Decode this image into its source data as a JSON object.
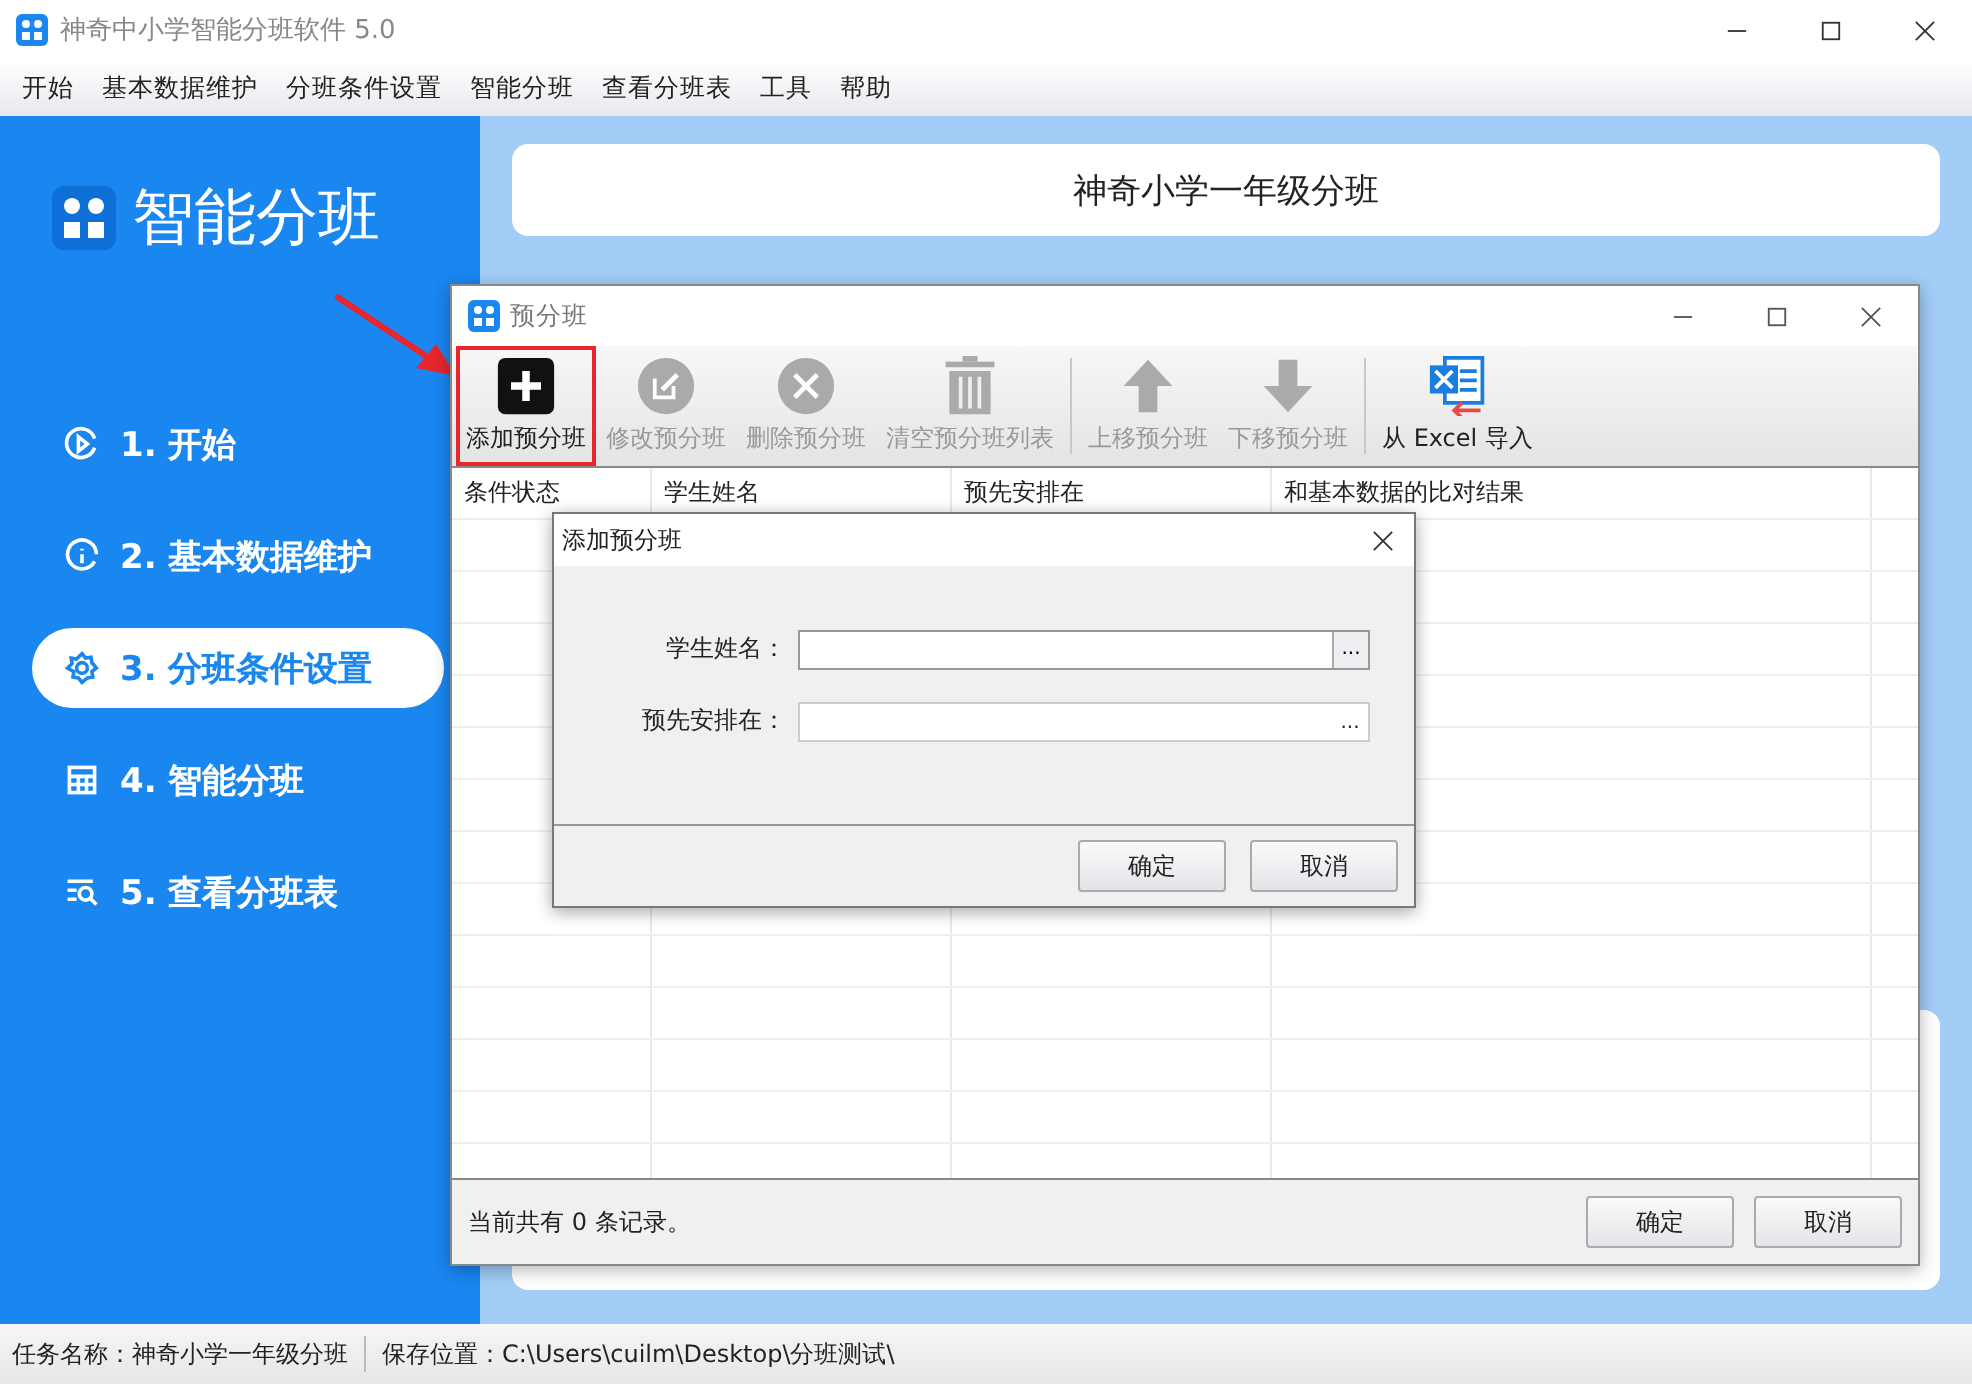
{
  "window": {
    "title": "神奇中小学智能分班软件 5.0"
  },
  "menu": [
    "开始",
    "基本数据维护",
    "分班条件设置",
    "智能分班",
    "查看分班表",
    "工具",
    "帮助"
  ],
  "sidebar": {
    "title": "智能分班",
    "items": [
      {
        "label": "1. 开始",
        "kind": "play",
        "selected": false
      },
      {
        "label": "2. 基本数据维护",
        "kind": "info",
        "selected": false
      },
      {
        "label": "3. 分班条件设置",
        "kind": "gear",
        "selected": true
      },
      {
        "label": "4. 智能分班",
        "kind": "grid",
        "selected": false
      },
      {
        "label": "5. 查看分班表",
        "kind": "search",
        "selected": false
      }
    ]
  },
  "header": {
    "title": "神奇小学一年级分班"
  },
  "dialog": {
    "title": "预分班",
    "toolbar": [
      [
        {
          "label": "添加预分班",
          "kind": "plus",
          "disabled": false,
          "highlighted": true
        },
        {
          "label": "修改预分班",
          "kind": "edit",
          "disabled": true,
          "highlighted": false
        },
        {
          "label": "删除预分班",
          "kind": "delete",
          "disabled": true,
          "highlighted": false
        },
        {
          "label": "清空预分班列表",
          "kind": "trash",
          "disabled": true,
          "highlighted": false
        }
      ],
      [
        {
          "label": "上移预分班",
          "kind": "up",
          "disabled": true,
          "highlighted": false
        },
        {
          "label": "下移预分班",
          "kind": "down",
          "disabled": true,
          "highlighted": false
        }
      ],
      [
        {
          "label": "从 Excel 导入",
          "kind": "excel",
          "disabled": false,
          "highlighted": false
        }
      ]
    ],
    "columns": [
      "条件状态",
      "学生姓名",
      "预先安排在",
      "和基本数据的比对结果"
    ],
    "record_count": "当前共有 0 条记录。",
    "buttons": [
      "确定",
      "取消"
    ]
  },
  "add_dialog": {
    "title": "添加预分班",
    "fields": [
      {
        "label": "学生姓名：",
        "kind": "browse",
        "button": "..."
      },
      {
        "label": "预先安排在：",
        "kind": "inline",
        "button": "..."
      }
    ],
    "buttons": [
      "确定",
      "取消"
    ]
  },
  "status_bar": {
    "task": "任务名称：神奇小学一年级分班",
    "location": "保存位置：C:\\Users\\cuilm\\Desktop\\分班测试\\"
  }
}
